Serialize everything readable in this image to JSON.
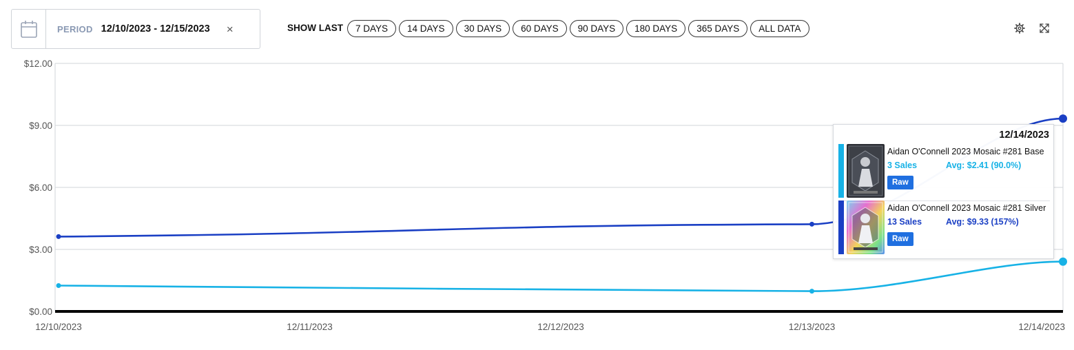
{
  "filters": {
    "period_label": "PERIOD",
    "period_value": "12/10/2023 - 12/15/2023",
    "clear_symbol": "×",
    "show_last_label": "SHOW LAST",
    "ranges": [
      "7 DAYS",
      "14 DAYS",
      "30 DAYS",
      "60 DAYS",
      "90 DAYS",
      "180 DAYS",
      "365 DAYS",
      "ALL DATA"
    ]
  },
  "toolbar": {
    "settings_icon": "gear-icon",
    "expand_icon": "expand-icon"
  },
  "chart_data": {
    "type": "line",
    "categories": [
      "12/10/2023",
      "12/11/2023",
      "12/12/2023",
      "12/13/2023",
      "12/14/2023"
    ],
    "ylim": [
      0,
      12
    ],
    "yticks": [
      0,
      3,
      6,
      9,
      12
    ],
    "ytick_labels": [
      "$0.00",
      "$3.00",
      "$6.00",
      "$9.00",
      "$12.00"
    ],
    "grid": true,
    "series": [
      {
        "name": "Aidan O'Connell 2023 Mosaic #281 Silver",
        "color": "#1a3fc4",
        "points": [
          [
            0,
            3.62
          ],
          [
            3,
            4.22
          ],
          [
            4,
            9.33
          ]
        ]
      },
      {
        "name": "Aidan O'Connell 2023 Mosaic #281 Base",
        "color": "#17b2e6",
        "points": [
          [
            0,
            1.25
          ],
          [
            3,
            0.98
          ],
          [
            4,
            2.41
          ]
        ]
      }
    ]
  },
  "tooltip": {
    "date": "12/14/2023",
    "items": [
      {
        "name": "Aidan O'Connell 2023 Mosaic #281 Base",
        "sales": "3 Sales",
        "avg": "Avg: $2.41 (90.0%)",
        "badge": "Raw",
        "color": "#17b2e6"
      },
      {
        "name": "Aidan O'Connell 2023 Mosaic #281 Silver",
        "sales": "13 Sales",
        "avg": "Avg: $9.33 (157%)",
        "badge": "Raw",
        "color": "#1a3fc4"
      }
    ]
  }
}
